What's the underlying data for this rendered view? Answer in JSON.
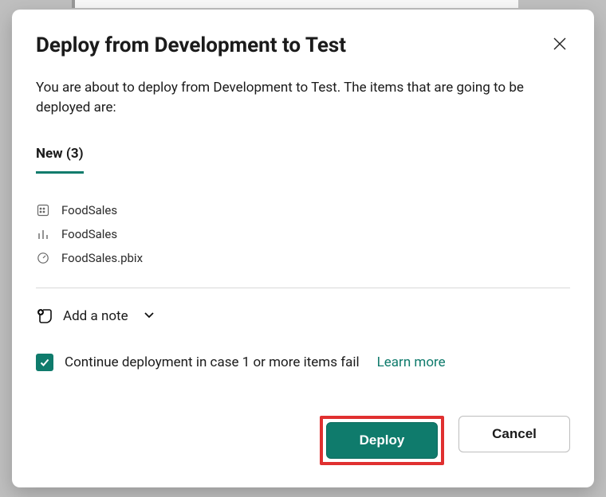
{
  "modal": {
    "title": "Deploy from Development to Test",
    "description": "You are about to deploy from Development to Test. The items that are going to be deployed are:",
    "tab_label": "New (3)",
    "items": [
      {
        "icon": "dataset-icon",
        "name": "FoodSales"
      },
      {
        "icon": "report-icon",
        "name": "FoodSales"
      },
      {
        "icon": "dashboard-icon",
        "name": "FoodSales.pbix"
      }
    ],
    "add_note_label": "Add a note",
    "continue_label": "Continue deployment in case 1 or more items fail",
    "learn_more_label": "Learn more",
    "deploy_label": "Deploy",
    "cancel_label": "Cancel"
  },
  "colors": {
    "accent": "#0f7b6c",
    "danger_highlight": "#e03030"
  }
}
